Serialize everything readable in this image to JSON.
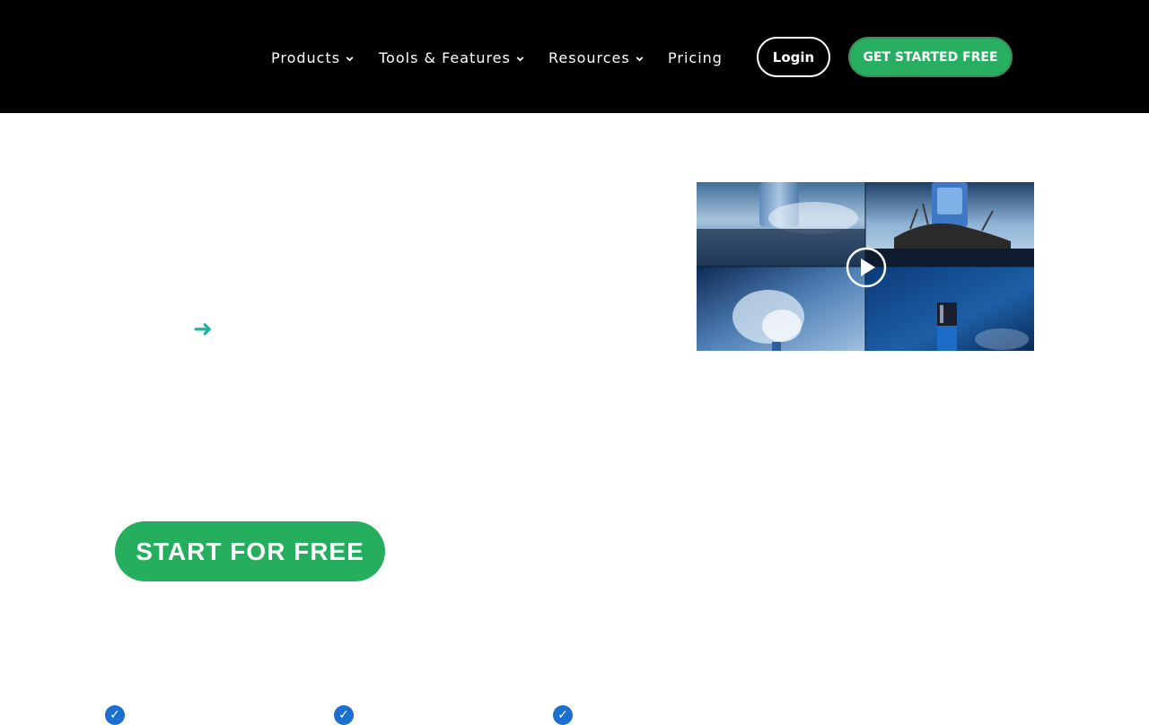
{
  "header": {
    "nav": [
      {
        "label": "Products",
        "has_dropdown": true
      },
      {
        "label": "Tools & Features",
        "has_dropdown": true
      },
      {
        "label": "Resources",
        "has_dropdown": true
      },
      {
        "label": "Pricing",
        "has_dropdown": false
      }
    ],
    "login_label": "Login",
    "get_started_label": "GET STARTED FREE"
  },
  "hero": {
    "arrow_icon": "arrow-right-icon",
    "video_icon": "play-icon",
    "start_label": "START FOR FREE"
  },
  "features": {
    "check_icon": "check-icon",
    "checks": [
      "✓",
      "✓",
      "✓"
    ]
  },
  "colors": {
    "header_bg": "#000000",
    "brand_green": "#27ae60",
    "arrow_teal": "#1db3a3",
    "check_blue": "#1a6fcf"
  }
}
